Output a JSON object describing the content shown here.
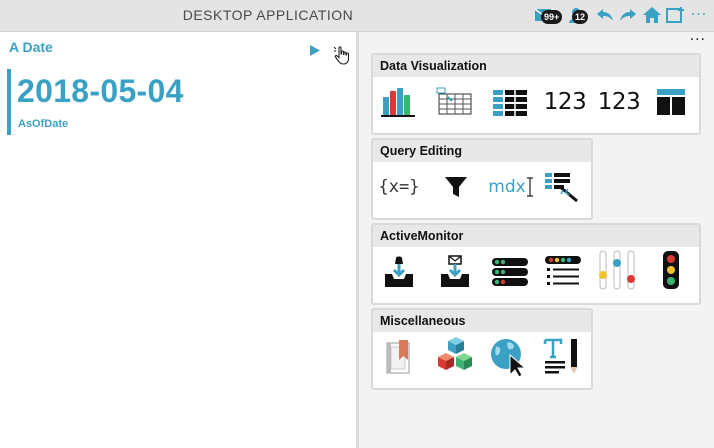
{
  "app": {
    "title": "DESKTOP APPLICATION",
    "messages_badge": "99+",
    "notifications_badge": "12",
    "more": "···"
  },
  "tile": {
    "title": "A Date",
    "value": "2018-05-04",
    "label": "AsOfDate"
  },
  "panel": {
    "more": "···"
  },
  "groups": {
    "data_visualization": {
      "title": "Data Visualization",
      "num1": "123",
      "num2": "123"
    },
    "query_editing": {
      "title": "Query Editing",
      "expr": "{x=}",
      "mdx": "mdx"
    },
    "active_monitor": {
      "title": "ActiveMonitor"
    },
    "misc": {
      "title": "Miscellaneous"
    }
  },
  "colors": {
    "accent": "#3aa1c4",
    "red": "#d93a35",
    "green": "#3cb371",
    "yellow": "#f2c230"
  }
}
